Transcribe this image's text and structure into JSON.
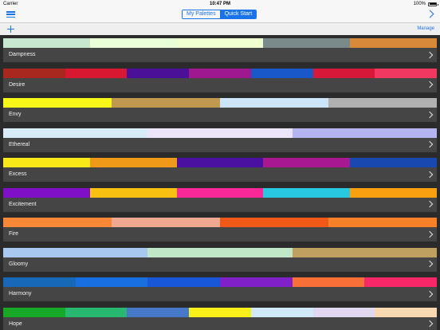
{
  "status": {
    "carrier": "Carrier",
    "time": "10:47 PM",
    "battery": "100%"
  },
  "nav": {
    "tabs": [
      "My Palettes",
      "Quick Start"
    ],
    "active_tab": "Quick Start"
  },
  "toolbar": {
    "manage_label": "Manage"
  },
  "palettes": [
    {
      "name": "Dampness",
      "colors": [
        "#c8e8d0",
        "#e8ffd8",
        "#f0ffd0",
        "#7a8a8a",
        "#d88a3a"
      ]
    },
    {
      "name": "Desire",
      "colors": [
        "#a82820",
        "#d81830",
        "#4a1098",
        "#a01890",
        "#1858c8",
        "#d81838",
        "#f03860"
      ]
    },
    {
      "name": "Envy",
      "colors": [
        "#f8f818",
        "#c09850",
        "#cce4f8",
        "#b0b0b0"
      ]
    },
    {
      "name": "Ethereal",
      "colors": [
        "#d8ecf8",
        "#ece4f8",
        "#b4b4f0"
      ]
    },
    {
      "name": "Excess",
      "colors": [
        "#f8e818",
        "#f09818",
        "#4a10a0",
        "#a81890",
        "#1848b0"
      ]
    },
    {
      "name": "Excitement",
      "colors": [
        "#8010c8",
        "#f8c010",
        "#f82898",
        "#28c8e0",
        "#f8a010"
      ]
    },
    {
      "name": "Fire",
      "colors": [
        "#f88838",
        "#f0a890",
        "#f05818",
        "#f88028"
      ]
    },
    {
      "name": "Gloomy",
      "colors": [
        "#a8c8f0",
        "#c0e8c8",
        "#c0a060"
      ]
    },
    {
      "name": "Harmony",
      "colors": [
        "#1868b8",
        "#1870e0",
        "#1858d8",
        "#8020c8",
        "#f87038",
        "#f82868"
      ]
    },
    {
      "name": "Hope",
      "colors": [
        "#18a828",
        "#28b870",
        "#4878c8",
        "#f8f018",
        "#d0e8f8",
        "#e0d8f0",
        "#f8d8b0"
      ]
    }
  ]
}
